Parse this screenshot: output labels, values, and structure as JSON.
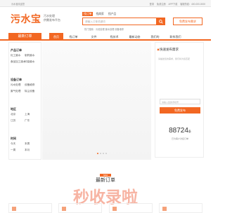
{
  "topbar": {
    "left_text": "污水宝欢迎您",
    "right_items": [
      "登录",
      "免费注册",
      "APP下载",
      "客服热线：400-000-0000"
    ]
  },
  "logo": {
    "title": "污水宝",
    "subtitle_line1": "污水处理",
    "subtitle_line2": "供需发布平台"
  },
  "search": {
    "tabs": [
      "找订单",
      "找商家",
      "找产品"
    ],
    "placeholder": "请输入订单关键词",
    "hotwords": "热门搜索：污泥处理  废水处理  设备维修"
  },
  "publish_button": "免费发布需求",
  "nav": {
    "category_label": "最新订单",
    "items": [
      "首页",
      "找订单",
      "文件",
      "找技术",
      "最新动态",
      "我们的",
      "联系我们"
    ]
  },
  "sidebar": [
    {
      "title": "产品订单",
      "rows": [
        [
          "化工废水",
          "制药废水"
        ],
        [
          "食品加工废水",
          "印染废水"
        ]
      ]
    },
    {
      "title": "设备订单",
      "rows": [
        [
          "污水处理",
          "设备维修"
        ],
        [
          "废气处理",
          "除尘设备"
        ]
      ]
    },
    {
      "title": "地区",
      "rows": [
        [
          "北京",
          "上海"
        ],
        [
          "江苏",
          "广东"
        ]
      ]
    },
    {
      "title": "时间",
      "rows": [
        [
          "今天",
          "本周"
        ],
        [
          "一周",
          "本月"
        ]
      ]
    }
  ],
  "panel": {
    "title": "快速发布需求",
    "hint": "请描述您的需求，我们将为您匹配",
    "phone_placeholder": "请输入您的手机号",
    "submit": "免费发布",
    "count": "88724",
    "count_unit": "条",
    "count_label": "已为客户对接订单"
  },
  "section": {
    "tag": "NEW",
    "title": "最新订单",
    "promo": "秒收录啦"
  },
  "colors": {
    "accent": "#f26722"
  }
}
